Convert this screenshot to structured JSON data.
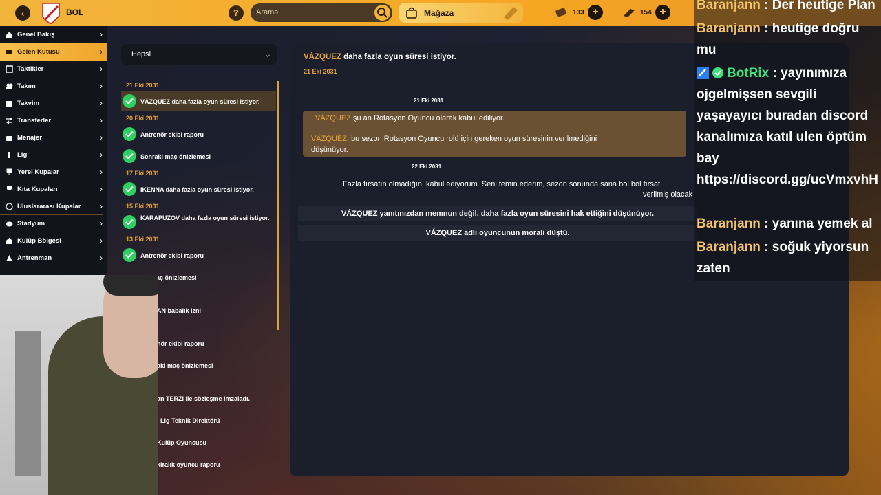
{
  "topbar": {
    "club_name": "BOL",
    "search_placeholder": "Arama",
    "store_label": "Mağaza",
    "currencies": [
      {
        "name": "coins",
        "value": "133"
      },
      {
        "name": "gold",
        "value": "154"
      }
    ]
  },
  "sidebar": {
    "items": [
      {
        "label": "Genel Bakış",
        "icon": "home-icon",
        "active": false
      },
      {
        "label": "Gelen Kutusu",
        "icon": "inbox-icon",
        "active": true
      },
      {
        "label": "Taktikler",
        "icon": "tactics-icon",
        "active": false
      },
      {
        "label": "Takım",
        "icon": "team-icon",
        "active": false
      },
      {
        "label": "Takvim",
        "icon": "calendar-icon",
        "active": false
      },
      {
        "label": "Transferler",
        "icon": "transfer-icon",
        "active": false
      },
      {
        "label": "Menajer",
        "icon": "manager-icon",
        "active": false
      },
      {
        "label": "Lig",
        "icon": "league-icon",
        "active": false
      },
      {
        "label": "Yerel Kupalar",
        "icon": "cup-icon",
        "active": false
      },
      {
        "label": "Kıta Kupaları",
        "icon": "continental-cup-icon",
        "active": false
      },
      {
        "label": "Uluslararası Kupalar",
        "icon": "globe-icon",
        "active": false
      },
      {
        "label": "Stadyum",
        "icon": "stadium-icon",
        "active": false
      },
      {
        "label": "Kulüp Bölgesi",
        "icon": "club-icon",
        "active": false
      },
      {
        "label": "Antrenman",
        "icon": "training-icon",
        "active": false
      }
    ]
  },
  "inbox": {
    "filter": "Hepsi",
    "dates": [
      "21 Eki 2031",
      "20 Eki 2031",
      "17 Eki 2031",
      "15 Eki 2031",
      "13 Eki 2031"
    ],
    "messages": [
      {
        "text": "VÁZQUEZ daha fazla oyun süresi istiyor."
      },
      {
        "text": "Antrenör ekibi raporu"
      },
      {
        "text": "Sonraki maç önizlemesi"
      },
      {
        "text": "IKENNA daha fazla oyun süresi istiyor."
      },
      {
        "text": "KARAPUZOV daha fazla oyun süresi istiyor."
      },
      {
        "text": "Antrenör ekibi raporu"
      },
      {
        "text": "aki maç önizlemesi"
      },
      {
        "text": "AN babalık izni"
      },
      {
        "text": "nör ekibi raporu"
      },
      {
        "text": "aki maç önizlemesi"
      },
      {
        "text": "an TERZI ile sözleşme imzaladı."
      },
      {
        "text": ". Lig Teknik Direktörü"
      },
      {
        "text": "Kulüp Oyuncusu"
      },
      {
        "text": "kiralık oyuncu raporu"
      }
    ]
  },
  "detail": {
    "title_player": "VÁZQUEZ",
    "title_rest": " daha fazla oyun süresi istiyor.",
    "date": "21 Eki 2031",
    "thread_date_1": "21 Eki 2031",
    "msg1_player": "VÁZQUEZ",
    "msg1_rest": " şu an Rotasyon Oyuncu olarak kabul ediliyor.",
    "msg2_player": "VÁZQUEZ",
    "msg2_rest": ", bu sezon Rotasyon Oyuncu rolü için gereken oyun süresinin verilmediğini",
    "msg2_rest2": "düşünüyor.",
    "thread_date_2": "22 Eki 2031",
    "reply_1": "Fazla fırsatın olmadığını kabul ediyorum. Seni temin ederim, sezon sonunda sana bol bol fırsat",
    "reply_2": "verilmiş olacak",
    "sys_1": "VÁZQUEZ yanıtınızdan memnun değil, daha fazla oyun süresini hak ettiğini düşünüyor.",
    "sys_2": "VÁZQUEZ adlı oyuncunun morali düştü."
  },
  "chat": {
    "lines": [
      {
        "user": "Baranjann",
        "text": " : Der heutige Plan"
      },
      {
        "user": "Baranjann",
        "text": " : heutige doğru mu"
      },
      {
        "user": "BotRix",
        "text": " : yayınımıza ojgelmişsen sevgili yaşayayıcı buradan discord kanalımıza katıl ulen öptüm bay https://discord.gg/ucVmxvhH"
      },
      {
        "user": "Baranjann",
        "text": " : yanına yemek al"
      },
      {
        "user": "Baranjann",
        "text": " : soğuk yiyorsun zaten"
      }
    ]
  },
  "colors": {
    "accent": "#f2b53c",
    "highlight": "#e6a23a",
    "check": "#2fd062"
  }
}
